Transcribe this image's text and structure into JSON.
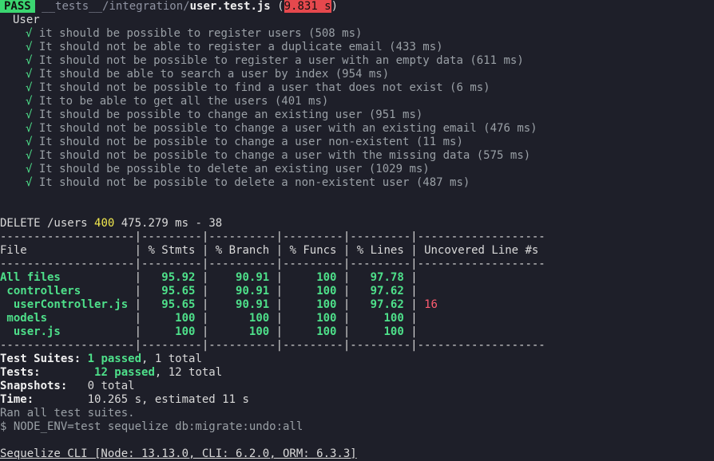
{
  "header": {
    "badge": "PASS",
    "path_dir": "__tests__/integration/",
    "path_file": "user.test.js",
    "paren_open": " (",
    "duration": "9.831 s",
    "paren_close": ")"
  },
  "suite_name": "User",
  "tests": [
    "it should be possible to register users (508 ms)",
    "It should not be able to register a duplicate email (433 ms)",
    "It should not be possible to register a user with an empty data (611 ms)",
    "It should be able to search a user by index (954 ms)",
    "It should not be possible to find a user that does not exist (6 ms)",
    "It to be able to get all the users (401 ms)",
    "It should be possible to change an existing user (951 ms)",
    "It should not be possible to change a user with an existing email (476 ms)",
    "It should not be possible to change a user non-existent (11 ms)",
    "It should not be possible to change a user with the missing data (575 ms)",
    "It should be possible to delete an existing user (1029 ms)",
    "It should not be possible to delete a non-existent user (487 ms)"
  ],
  "check_mark": "√",
  "log": {
    "method_path": "DELETE /users ",
    "status": "400",
    "rest": " 475.279 ms - 38"
  },
  "coverage": {
    "rule": "--------------------|---------|----------|---------|---------|-------------------",
    "headers": [
      "File",
      "% Stmts",
      "% Branch",
      "% Funcs",
      "% Lines",
      "Uncovered Line #s"
    ],
    "rows": [
      {
        "file": "All files",
        "stmts": "95.92",
        "branch": "90.91",
        "funcs": "100",
        "lines": "97.78",
        "uncovered": "",
        "level": 0
      },
      {
        "file": "controllers",
        "stmts": "95.65",
        "branch": "90.91",
        "funcs": "100",
        "lines": "97.62",
        "uncovered": "",
        "level": 1
      },
      {
        "file": "userController.js",
        "stmts": "95.65",
        "branch": "90.91",
        "funcs": "100",
        "lines": "97.62",
        "uncovered": "16",
        "level": 2
      },
      {
        "file": "models",
        "stmts": "100",
        "branch": "100",
        "funcs": "100",
        "lines": "100",
        "uncovered": "",
        "level": 1
      },
      {
        "file": "user.js",
        "stmts": "100",
        "branch": "100",
        "funcs": "100",
        "lines": "100",
        "uncovered": "",
        "level": 2
      }
    ]
  },
  "summary": {
    "suites_label": "Test Suites:",
    "suites_passed": "1 passed",
    "suites_total": ", 1 total",
    "tests_label": "Tests:",
    "tests_passed": "12 passed",
    "tests_total": ", 12 total",
    "snap_label": "Snapshots:",
    "snap_value": "0 total",
    "time_label": "Time:",
    "time_value": "10.265 s, estimated 11 s",
    "ran_all": "Ran all test suites."
  },
  "command": "$ NODE_ENV=test sequelize db:migrate:undo:all",
  "cli_info": "Sequelize CLI [Node: 13.13.0, CLI: 6.2.0, ORM: 6.3.3]",
  "colors": {
    "background": "#1e1f29",
    "pass_badge": "#3bd671",
    "duration_badge": "#e5484d",
    "success": "#4ee08a",
    "status_400": "#f2e94e",
    "uncovered": "#ff5c70"
  }
}
